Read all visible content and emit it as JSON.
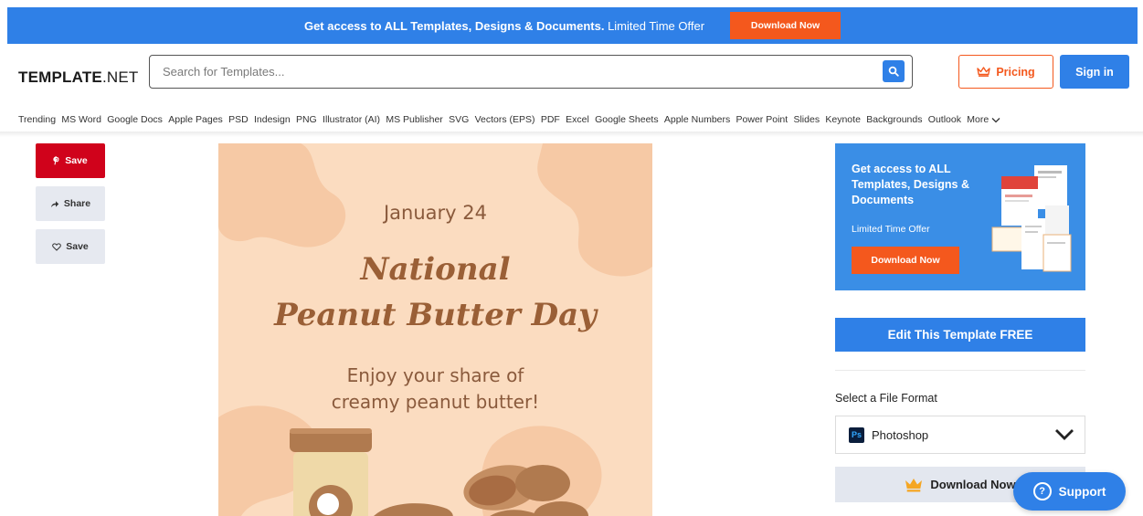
{
  "promo_bar": {
    "text_bold": "Get access to ALL Templates, Designs & Documents.",
    "text_light": "Limited Time Offer",
    "button": "Download Now"
  },
  "header": {
    "logo_bold": "TEMPLATE",
    "logo_light": ".NET",
    "search_placeholder": "Search for Templates...",
    "pricing": "Pricing",
    "signin": "Sign in"
  },
  "categories": [
    "Trending",
    "MS Word",
    "Google Docs",
    "Apple Pages",
    "PSD",
    "Indesign",
    "PNG",
    "Illustrator (AI)",
    "MS Publisher",
    "SVG",
    "Vectors (EPS)",
    "PDF",
    "Excel",
    "Google Sheets",
    "Apple Numbers",
    "Power Point",
    "Slides",
    "Keynote",
    "Backgrounds",
    "Outlook"
  ],
  "more_label": "More",
  "sidebar": {
    "pin_save": "Save",
    "share": "Share",
    "heart_save": "Save"
  },
  "preview": {
    "date": "January 24",
    "title_line1": "National",
    "title_line2": "Peanut Butter Day",
    "sub_line1": "Enjoy your share of",
    "sub_line2": "creamy peanut butter!"
  },
  "promo_card": {
    "heading": "Get access to ALL Templates, Designs & Documents",
    "offer": "Limited Time Offer",
    "button": "Download Now"
  },
  "edit_button": "Edit This Template FREE",
  "file_format": {
    "label": "Select a File Format",
    "icon_text": "Ps",
    "selected": "Photoshop"
  },
  "download_button": "Download Now",
  "support_button": "Support",
  "colors": {
    "brand_blue": "#2f80e7",
    "accent_orange": "#f4581d",
    "pinterest_red": "#d0021b",
    "preview_bg": "#fbdcc0"
  }
}
